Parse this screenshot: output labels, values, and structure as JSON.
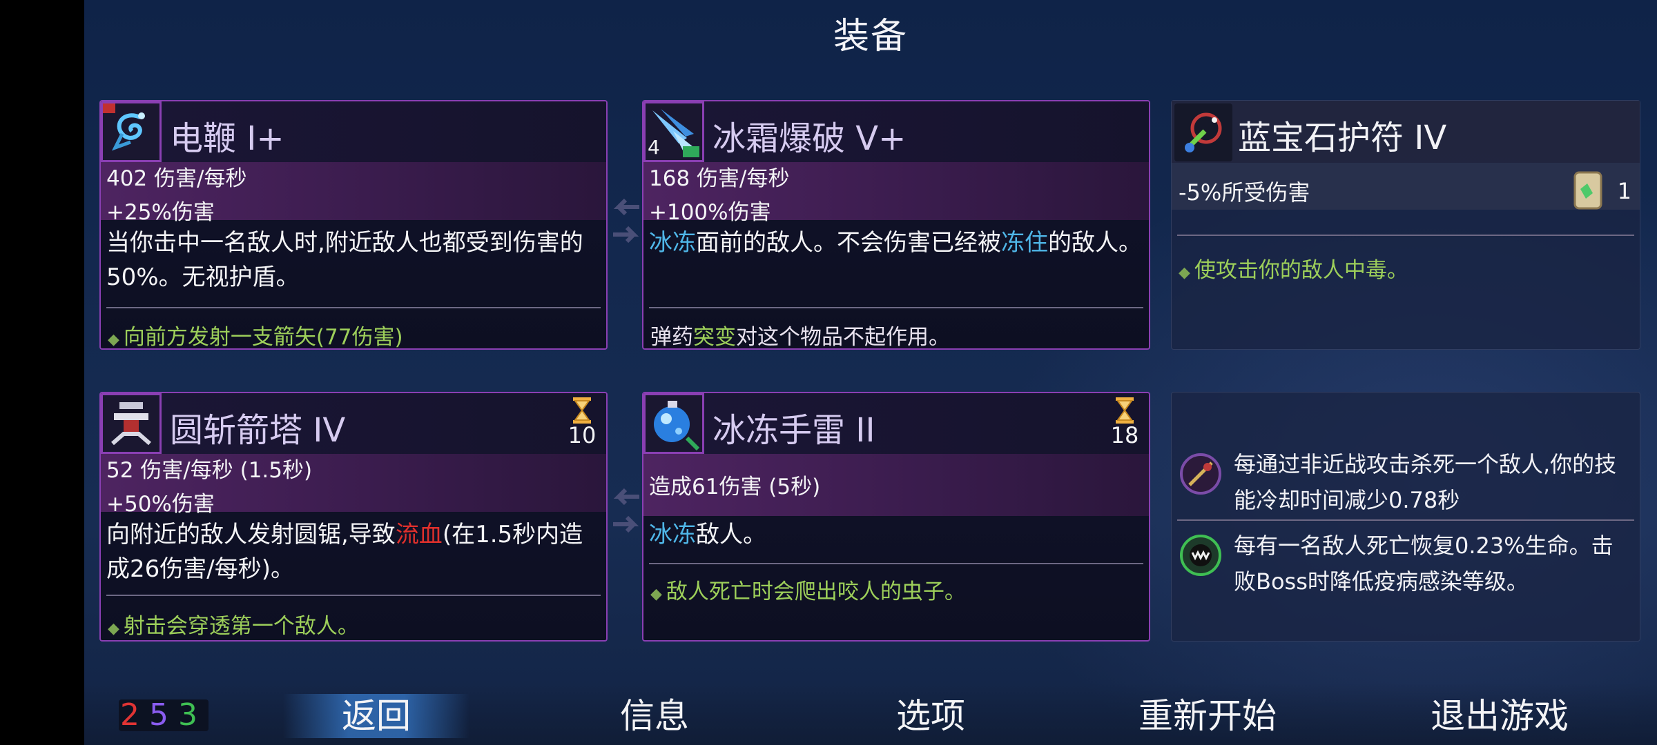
{
  "screen_title": "装备",
  "weapons": [
    {
      "title": "电鞭 I+",
      "icon": "electric-whip-icon",
      "stat_line1": "402 伤害/每秒",
      "stat_line2": "+25%伤害",
      "description": "当你击中一名敌人时,附近敌人也都受到伤害的50%。无视护盾。",
      "upgrade": "向前方发射一支箭矢(77伤害)"
    },
    {
      "title": "冰霜爆破 V+",
      "icon": "frost-blast-icon",
      "icon_badge": "4",
      "stat_line1": "168 伤害/每秒",
      "stat_line2": "+100%伤害",
      "desc_part1": "冰冻",
      "desc_part2": "面前的敌人。不会伤害已经被",
      "desc_part3": "冻住",
      "desc_part4": "的敌人。",
      "upgrade_part1": "弹药",
      "upgrade_part2": "突变",
      "upgrade_part3": "对这个物品不起作用。"
    }
  ],
  "skills": [
    {
      "title": "圆斩箭塔 IV",
      "icon": "saw-turret-icon",
      "cooldown": "10",
      "stat_line1": "52 伤害/每秒 (1.5秒)",
      "stat_line2": "+50%伤害",
      "desc_part1": "向附近的敌人发射圆锯,导致",
      "desc_part2": "流血",
      "desc_part3": "(在1.5秒内造成26伤害/每秒)。",
      "upgrade": "射击会穿透第一个敌人。"
    },
    {
      "title": "冰冻手雷 II",
      "icon": "ice-grenade-icon",
      "cooldown": "18",
      "stat_line1": "造成61伤害 (5秒)",
      "desc_part1": "冰冻",
      "desc_part2": "敌人。",
      "upgrade": "敌人死亡时会爬出咬人的虫子。"
    }
  ],
  "amulet": {
    "title": "蓝宝石护符 IV",
    "icon": "sapphire-amulet-icon",
    "stat": "-5%所受伤害",
    "scroll_count": "1",
    "effect": "使攻击你的敌人中毒。"
  },
  "mutations": [
    {
      "icon": "ranged-kill-mutation-icon",
      "text": "每通过非近战攻击杀死一个敌人,你的技能冷却时间减少0.78秒"
    },
    {
      "icon": "heal-on-kill-mutation-icon",
      "text": "每有一名敌人死亡恢复0.23%生命。击败Boss时降低疫病感染等级。"
    }
  ],
  "scroll_stats": {
    "brutality": "2",
    "tactics": "5",
    "survival": "3",
    "colors": {
      "brutality": "#e23434",
      "tactics": "#8a5cf0",
      "survival": "#3fbf53"
    }
  },
  "menu": {
    "back": "返回",
    "info": "信息",
    "options": "选项",
    "restart": "重新开始",
    "quit": "退出游戏"
  }
}
